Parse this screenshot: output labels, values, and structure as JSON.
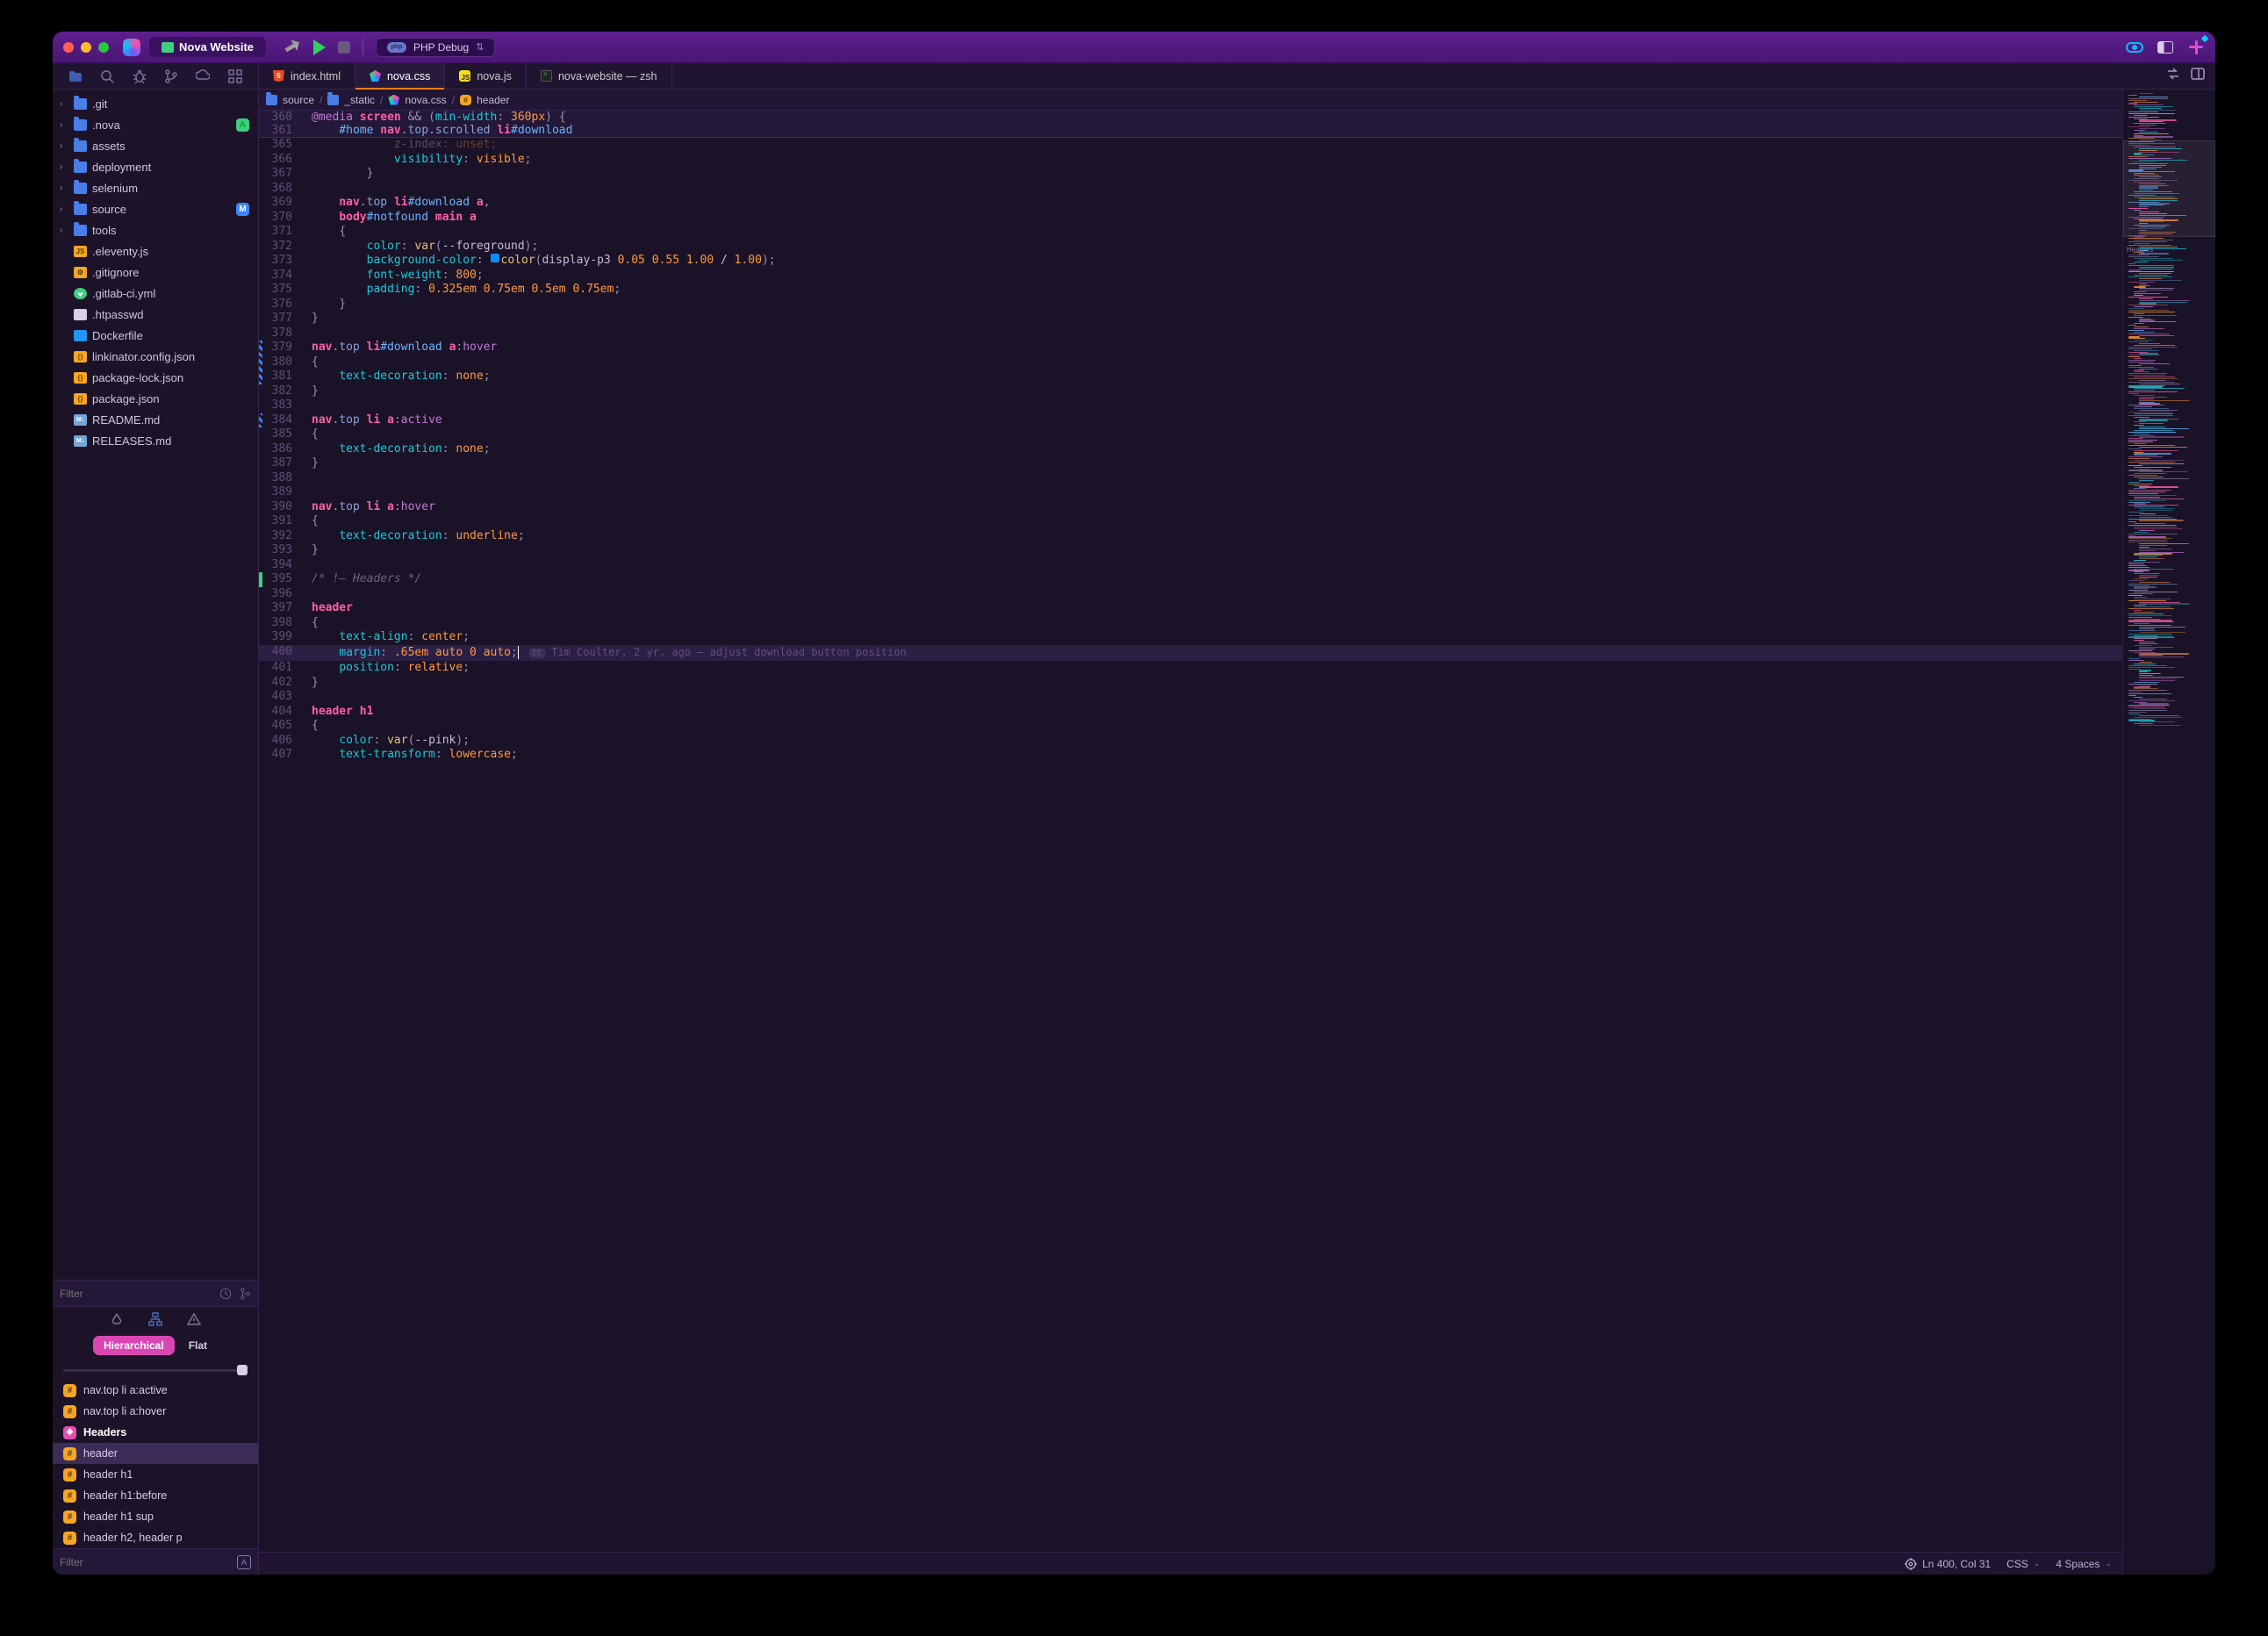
{
  "titlebar": {
    "project_name": "Nova Website",
    "debug_label": "PHP Debug"
  },
  "sidebar_tools": [
    "files",
    "search",
    "bug",
    "branch",
    "cloud",
    "grid"
  ],
  "tabs": [
    {
      "icon": "html5",
      "label": "index.html",
      "active": false
    },
    {
      "icon": "nova",
      "label": "nova.css",
      "active": true
    },
    {
      "icon": "js",
      "label": "nova.js",
      "active": false
    },
    {
      "icon": "term",
      "label": "nova-website — zsh",
      "active": false
    }
  ],
  "file_tree": [
    {
      "type": "folder",
      "name": ".git",
      "expandable": true
    },
    {
      "type": "folder",
      "name": ".nova",
      "expandable": true,
      "badge": "A"
    },
    {
      "type": "folder",
      "name": "assets",
      "expandable": true
    },
    {
      "type": "folder",
      "name": "deployment",
      "expandable": true
    },
    {
      "type": "folder",
      "name": "selenium",
      "expandable": true
    },
    {
      "type": "folder",
      "name": "source",
      "expandable": true,
      "badge": "M"
    },
    {
      "type": "folder",
      "name": "tools",
      "expandable": true
    },
    {
      "type": "file",
      "icon": "jsfile",
      "name": ".eleventy.js"
    },
    {
      "type": "file",
      "icon": "cfg",
      "name": ".gitignore"
    },
    {
      "type": "file",
      "icon": "yml",
      "name": ".gitlab-ci.yml"
    },
    {
      "type": "file",
      "icon": "txt",
      "name": ".htpasswd"
    },
    {
      "type": "file",
      "icon": "docker",
      "name": "Dockerfile"
    },
    {
      "type": "file",
      "icon": "json",
      "name": "linkinator.config.json"
    },
    {
      "type": "file",
      "icon": "json",
      "name": "package-lock.json"
    },
    {
      "type": "file",
      "icon": "json",
      "name": "package.json"
    },
    {
      "type": "file",
      "icon": "md",
      "name": "README.md"
    },
    {
      "type": "file",
      "icon": "md",
      "name": "RELEASES.md"
    }
  ],
  "filter_top_placeholder": "Filter",
  "filter_bottom_placeholder": "Filter",
  "view_toggle": {
    "hierarchical": "Hierarchical",
    "flat": "Flat"
  },
  "symbols": [
    {
      "kind": "rule",
      "label": "nav.top li a:active"
    },
    {
      "kind": "rule",
      "label": "nav.top li a:hover"
    },
    {
      "kind": "section",
      "label": "Headers",
      "heading": true
    },
    {
      "kind": "rule",
      "label": "header",
      "selected": true
    },
    {
      "kind": "rule",
      "label": "header h1"
    },
    {
      "kind": "rule",
      "label": "header h1:before"
    },
    {
      "kind": "rule",
      "label": "header h1 sup"
    },
    {
      "kind": "rule",
      "label": "header h2, header p"
    }
  ],
  "breadcrumb": [
    {
      "icon": "folder",
      "label": "source"
    },
    {
      "icon": "folder",
      "label": "_static"
    },
    {
      "icon": "nova",
      "label": "nova.css"
    },
    {
      "icon": "rule",
      "label": "header"
    }
  ],
  "sticky": [
    {
      "n": "360",
      "segs": [
        {
          "c": "k-at",
          "t": "@media"
        },
        {
          "c": "k-plain",
          "t": " "
        },
        {
          "c": "k-kw",
          "t": "screen"
        },
        {
          "c": "k-plain",
          "t": " "
        },
        {
          "c": "k-punc",
          "t": "&&"
        },
        {
          "c": "k-plain",
          "t": " "
        },
        {
          "c": "k-punc",
          "t": "("
        },
        {
          "c": "k-prop",
          "t": "min-width"
        },
        {
          "c": "k-punc",
          "t": ": "
        },
        {
          "c": "k-num",
          "t": "360px"
        },
        {
          "c": "k-punc",
          "t": ") "
        },
        {
          "c": "k-brace",
          "t": "{"
        }
      ]
    },
    {
      "n": "361",
      "segs": [
        {
          "c": "k-plain",
          "t": "    "
        },
        {
          "c": "k-id",
          "t": "#home"
        },
        {
          "c": "k-plain",
          "t": " "
        },
        {
          "c": "k-tag",
          "t": "nav"
        },
        {
          "c": "k-cls",
          "t": ".top.scrolled"
        },
        {
          "c": "k-plain",
          "t": " "
        },
        {
          "c": "k-tag",
          "t": "li"
        },
        {
          "c": "k-id",
          "t": "#download"
        }
      ]
    }
  ],
  "code": [
    {
      "n": "365",
      "segs": [
        {
          "c": "k-plain",
          "t": "            z-index"
        },
        {
          "c": "k-punc",
          "t": ": "
        },
        {
          "c": "k-val",
          "t": "unset"
        },
        {
          "c": "k-punc",
          "t": ";"
        }
      ],
      "dim": true
    },
    {
      "n": "366",
      "segs": [
        {
          "c": "k-plain",
          "t": "            "
        },
        {
          "c": "k-prop",
          "t": "visibility"
        },
        {
          "c": "k-punc",
          "t": ": "
        },
        {
          "c": "k-val",
          "t": "visible"
        },
        {
          "c": "k-punc",
          "t": ";"
        }
      ]
    },
    {
      "n": "367",
      "segs": [
        {
          "c": "k-plain",
          "t": "        "
        },
        {
          "c": "k-brace",
          "t": "}"
        }
      ]
    },
    {
      "n": "368",
      "segs": []
    },
    {
      "n": "369",
      "segs": [
        {
          "c": "k-plain",
          "t": "    "
        },
        {
          "c": "k-tag",
          "t": "nav"
        },
        {
          "c": "k-cls",
          "t": ".top"
        },
        {
          "c": "k-plain",
          "t": " "
        },
        {
          "c": "k-tag",
          "t": "li"
        },
        {
          "c": "k-id",
          "t": "#download"
        },
        {
          "c": "k-plain",
          "t": " "
        },
        {
          "c": "k-tag",
          "t": "a"
        },
        {
          "c": "k-punc",
          "t": ","
        }
      ]
    },
    {
      "n": "370",
      "segs": [
        {
          "c": "k-plain",
          "t": "    "
        },
        {
          "c": "k-tag",
          "t": "body"
        },
        {
          "c": "k-id",
          "t": "#notfound"
        },
        {
          "c": "k-plain",
          "t": " "
        },
        {
          "c": "k-tag",
          "t": "main"
        },
        {
          "c": "k-plain",
          "t": " "
        },
        {
          "c": "k-tag",
          "t": "a"
        }
      ]
    },
    {
      "n": "371",
      "segs": [
        {
          "c": "k-plain",
          "t": "    "
        },
        {
          "c": "k-brace",
          "t": "{"
        }
      ]
    },
    {
      "n": "372",
      "segs": [
        {
          "c": "k-plain",
          "t": "        "
        },
        {
          "c": "k-prop",
          "t": "color"
        },
        {
          "c": "k-punc",
          "t": ": "
        },
        {
          "c": "k-fn",
          "t": "var"
        },
        {
          "c": "k-punc",
          "t": "("
        },
        {
          "c": "k-plain",
          "t": "--foreground"
        },
        {
          "c": "k-punc",
          "t": ");"
        }
      ]
    },
    {
      "n": "373",
      "segs": [
        {
          "c": "k-plain",
          "t": "        "
        },
        {
          "c": "k-prop",
          "t": "background-color"
        },
        {
          "c": "k-punc",
          "t": ": "
        },
        {
          "c": "k-swatch",
          "t": " "
        },
        {
          "c": "k-fn",
          "t": "color"
        },
        {
          "c": "k-punc",
          "t": "("
        },
        {
          "c": "k-plain",
          "t": "display-p3 "
        },
        {
          "c": "k-num",
          "t": "0.05 0.55 1.00"
        },
        {
          "c": "k-plain",
          "t": " / "
        },
        {
          "c": "k-num",
          "t": "1.00"
        },
        {
          "c": "k-punc",
          "t": ");"
        }
      ]
    },
    {
      "n": "374",
      "segs": [
        {
          "c": "k-plain",
          "t": "        "
        },
        {
          "c": "k-prop",
          "t": "font-weight"
        },
        {
          "c": "k-punc",
          "t": ": "
        },
        {
          "c": "k-num",
          "t": "800"
        },
        {
          "c": "k-punc",
          "t": ";"
        }
      ]
    },
    {
      "n": "375",
      "segs": [
        {
          "c": "k-plain",
          "t": "        "
        },
        {
          "c": "k-prop",
          "t": "padding"
        },
        {
          "c": "k-punc",
          "t": ": "
        },
        {
          "c": "k-num",
          "t": "0.325em 0.75em 0.5em 0.75em"
        },
        {
          "c": "k-punc",
          "t": ";"
        }
      ]
    },
    {
      "n": "376",
      "segs": [
        {
          "c": "k-plain",
          "t": "    "
        },
        {
          "c": "k-brace",
          "t": "}"
        }
      ]
    },
    {
      "n": "377",
      "segs": [
        {
          "c": "k-brace",
          "t": "}"
        }
      ]
    },
    {
      "n": "378",
      "segs": []
    },
    {
      "n": "379",
      "gc": "mod",
      "segs": [
        {
          "c": "k-tag",
          "t": "nav"
        },
        {
          "c": "k-cls",
          "t": ".top"
        },
        {
          "c": "k-plain",
          "t": " "
        },
        {
          "c": "k-tag",
          "t": "li"
        },
        {
          "c": "k-id",
          "t": "#download"
        },
        {
          "c": "k-plain",
          "t": " "
        },
        {
          "c": "k-tag",
          "t": "a"
        },
        {
          "c": "k-ps",
          "t": ":hover"
        }
      ]
    },
    {
      "n": "380",
      "gc": "mod",
      "segs": [
        {
          "c": "k-brace",
          "t": "{"
        }
      ]
    },
    {
      "n": "381",
      "gc": "mod",
      "segs": [
        {
          "c": "k-plain",
          "t": "    "
        },
        {
          "c": "k-prop",
          "t": "text-decoration"
        },
        {
          "c": "k-punc",
          "t": ": "
        },
        {
          "c": "k-val",
          "t": "none"
        },
        {
          "c": "k-punc",
          "t": ";"
        }
      ]
    },
    {
      "n": "382",
      "segs": [
        {
          "c": "k-brace",
          "t": "}"
        }
      ]
    },
    {
      "n": "383",
      "segs": []
    },
    {
      "n": "384",
      "gc": "mod",
      "segs": [
        {
          "c": "k-tag",
          "t": "nav"
        },
        {
          "c": "k-cls",
          "t": ".top"
        },
        {
          "c": "k-plain",
          "t": " "
        },
        {
          "c": "k-tag",
          "t": "li"
        },
        {
          "c": "k-plain",
          "t": " "
        },
        {
          "c": "k-tag",
          "t": "a"
        },
        {
          "c": "k-ps",
          "t": ":active"
        }
      ]
    },
    {
      "n": "385",
      "segs": [
        {
          "c": "k-brace",
          "t": "{"
        }
      ]
    },
    {
      "n": "386",
      "segs": [
        {
          "c": "k-plain",
          "t": "    "
        },
        {
          "c": "k-prop",
          "t": "text-decoration"
        },
        {
          "c": "k-punc",
          "t": ": "
        },
        {
          "c": "k-val",
          "t": "none"
        },
        {
          "c": "k-punc",
          "t": ";"
        }
      ]
    },
    {
      "n": "387",
      "segs": [
        {
          "c": "k-brace",
          "t": "}"
        }
      ]
    },
    {
      "n": "388",
      "segs": []
    },
    {
      "n": "389",
      "segs": []
    },
    {
      "n": "390",
      "segs": [
        {
          "c": "k-tag",
          "t": "nav"
        },
        {
          "c": "k-cls",
          "t": ".top"
        },
        {
          "c": "k-plain",
          "t": " "
        },
        {
          "c": "k-tag",
          "t": "li"
        },
        {
          "c": "k-plain",
          "t": " "
        },
        {
          "c": "k-tag",
          "t": "a"
        },
        {
          "c": "k-ps",
          "t": ":hover"
        }
      ]
    },
    {
      "n": "391",
      "segs": [
        {
          "c": "k-brace",
          "t": "{"
        }
      ]
    },
    {
      "n": "392",
      "segs": [
        {
          "c": "k-plain",
          "t": "    "
        },
        {
          "c": "k-prop",
          "t": "text-decoration"
        },
        {
          "c": "k-punc",
          "t": ": "
        },
        {
          "c": "k-val",
          "t": "underline"
        },
        {
          "c": "k-punc",
          "t": ";"
        }
      ]
    },
    {
      "n": "393",
      "segs": [
        {
          "c": "k-brace",
          "t": "}"
        }
      ]
    },
    {
      "n": "394",
      "segs": []
    },
    {
      "n": "395",
      "gc": "add",
      "segs": [
        {
          "c": "k-cmt",
          "t": "/* !— Headers */"
        }
      ]
    },
    {
      "n": "396",
      "segs": []
    },
    {
      "n": "397",
      "segs": [
        {
          "c": "k-tag",
          "t": "header"
        }
      ]
    },
    {
      "n": "398",
      "segs": [
        {
          "c": "k-brace",
          "t": "{"
        }
      ]
    },
    {
      "n": "399",
      "segs": [
        {
          "c": "k-plain",
          "t": "    "
        },
        {
          "c": "k-prop",
          "t": "text-align"
        },
        {
          "c": "k-punc",
          "t": ": "
        },
        {
          "c": "k-val",
          "t": "center"
        },
        {
          "c": "k-punc",
          "t": ";"
        }
      ]
    },
    {
      "n": "400",
      "current": true,
      "segs": [
        {
          "c": "k-plain",
          "t": "    "
        },
        {
          "c": "k-prop",
          "t": "margin"
        },
        {
          "c": "k-punc",
          "t": ": "
        },
        {
          "c": "k-num",
          "t": ".65em"
        },
        {
          "c": "k-plain",
          "t": " "
        },
        {
          "c": "k-val",
          "t": "auto"
        },
        {
          "c": "k-plain",
          "t": " "
        },
        {
          "c": "k-num",
          "t": "0"
        },
        {
          "c": "k-plain",
          "t": " "
        },
        {
          "c": "k-val",
          "t": "auto"
        },
        {
          "c": "k-punc",
          "t": ";"
        }
      ],
      "cursor": true,
      "blame": {
        "badge": "TC",
        "text": "Tim Coulter, 2 yr. ago — adjust download button position"
      }
    },
    {
      "n": "401",
      "segs": [
        {
          "c": "k-plain",
          "t": "    "
        },
        {
          "c": "k-prop",
          "t": "position"
        },
        {
          "c": "k-punc",
          "t": ": "
        },
        {
          "c": "k-val",
          "t": "relative"
        },
        {
          "c": "k-punc",
          "t": ";"
        }
      ]
    },
    {
      "n": "402",
      "segs": [
        {
          "c": "k-brace",
          "t": "}"
        }
      ]
    },
    {
      "n": "403",
      "segs": []
    },
    {
      "n": "404",
      "segs": [
        {
          "c": "k-tag",
          "t": "header"
        },
        {
          "c": "k-plain",
          "t": " "
        },
        {
          "c": "k-tag",
          "t": "h1"
        }
      ]
    },
    {
      "n": "405",
      "segs": [
        {
          "c": "k-brace",
          "t": "{"
        }
      ]
    },
    {
      "n": "406",
      "segs": [
        {
          "c": "k-plain",
          "t": "    "
        },
        {
          "c": "k-prop",
          "t": "color"
        },
        {
          "c": "k-punc",
          "t": ": "
        },
        {
          "c": "k-fn",
          "t": "var"
        },
        {
          "c": "k-punc",
          "t": "("
        },
        {
          "c": "k-plain",
          "t": "--pink"
        },
        {
          "c": "k-punc",
          "t": ");"
        }
      ]
    },
    {
      "n": "407",
      "segs": [
        {
          "c": "k-plain",
          "t": "    "
        },
        {
          "c": "k-prop",
          "t": "text-transform"
        },
        {
          "c": "k-punc",
          "t": ": "
        },
        {
          "c": "k-val",
          "t": "lowercase"
        },
        {
          "c": "k-punc",
          "t": ";"
        }
      ]
    }
  ],
  "minimap_section": "Headers",
  "statusbar": {
    "cursor": "Ln 400, Col 31",
    "lang": "CSS",
    "indent": "4 Spaces"
  }
}
